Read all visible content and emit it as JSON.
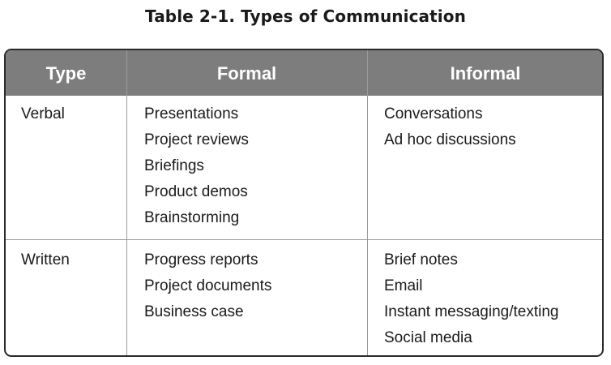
{
  "title": "Table 2-1. Types of Communication",
  "columns": [
    "Type",
    "Formal",
    "Informal"
  ],
  "rows": [
    {
      "type": "Verbal",
      "formal": [
        "Presentations",
        "Project reviews",
        "Briefings",
        "Product demos",
        "Brainstorming"
      ],
      "informal": [
        "Conversations",
        "Ad hoc discussions"
      ]
    },
    {
      "type": "Written",
      "formal": [
        "Progress reports",
        "Project documents",
        "Business case"
      ],
      "informal": [
        "Brief notes",
        "Email",
        "Instant messaging/texting",
        "Social media"
      ]
    }
  ],
  "colors": {
    "header_bg": "#7d7d7d",
    "header_text": "#ffffff",
    "border": "#2a2a2a"
  }
}
